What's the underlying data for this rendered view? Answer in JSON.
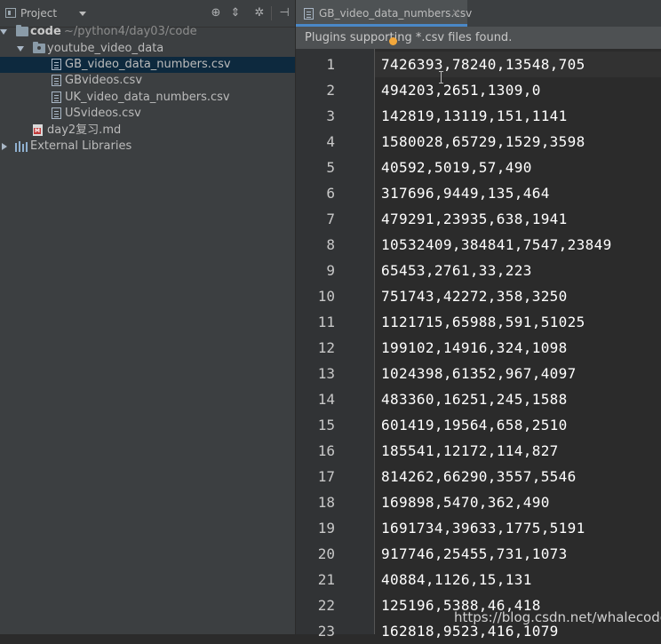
{
  "project_panel": {
    "title": "Project",
    "tree": {
      "root": {
        "name": "code",
        "path": "~/python4/day03/code"
      },
      "folder": {
        "name": "youtube_video_data"
      },
      "files": [
        "GB_video_data_numbers.csv",
        "GBvideos.csv",
        "UK_video_data_numbers.csv",
        "USvideos.csv"
      ],
      "md_file": "day2复习.md",
      "external": "External Libraries"
    },
    "toolbar_icons": [
      "locate-icon",
      "collapse-icon",
      "gear-icon",
      "hide-icon"
    ]
  },
  "editor": {
    "tab_label": "GB_video_data_numbers.csv",
    "tab_close": "×",
    "notice": "Plugins supporting *.csv files found.",
    "lines": [
      "7426393,78240,13548,705",
      "494203,2651,1309,0",
      "142819,13119,151,1141",
      "1580028,65729,1529,3598",
      "40592,5019,57,490",
      "317696,9449,135,464",
      "479291,23935,638,1941",
      "10532409,384841,7547,23849",
      "65453,2761,33,223",
      "751743,42272,358,3250",
      "1121715,65988,591,51025",
      "199102,14916,324,1098",
      "1024398,61352,967,4097",
      "483360,16251,245,1588",
      "601419,19564,658,2510",
      "185541,12172,114,827",
      "814262,66290,3557,5546",
      "169898,5470,362,490",
      "1691734,39633,1775,5191",
      "917746,25455,731,1073",
      "40884,1126,15,131",
      "125196,5388,46,418",
      "162818,9523,416,1079"
    ]
  },
  "watermark": "https://blog.csdn.net/whalecode"
}
